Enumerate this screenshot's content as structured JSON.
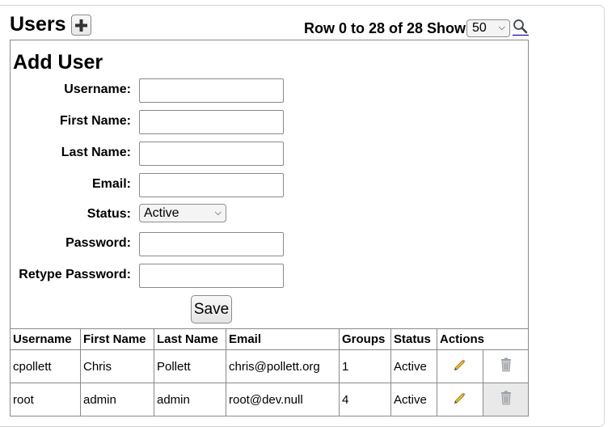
{
  "header": {
    "title": "Users",
    "add_icon": "plus-icon",
    "pager_text": "Row 0 to 28 of 28 Show",
    "show_count": "50",
    "search_icon": "magnifier-icon"
  },
  "form": {
    "title": "Add User",
    "fields": {
      "username": {
        "label": "Username:",
        "value": ""
      },
      "first_name": {
        "label": "First Name:",
        "value": ""
      },
      "last_name": {
        "label": "Last Name:",
        "value": ""
      },
      "email": {
        "label": "Email:",
        "value": ""
      },
      "status": {
        "label": "Status:",
        "value": "Active"
      },
      "password": {
        "label": "Password:",
        "value": ""
      },
      "retype_password": {
        "label": "Retype Password:",
        "value": ""
      }
    },
    "save_label": "Save"
  },
  "table": {
    "headers": [
      "Username",
      "First Name",
      "Last Name",
      "Email",
      "Groups",
      "Status",
      "Actions"
    ],
    "rows": [
      {
        "username": "cpollett",
        "first_name": "Chris",
        "last_name": "Pollett",
        "email": "chris@pollett.org",
        "groups": "1",
        "status": "Active"
      },
      {
        "username": "root",
        "first_name": "admin",
        "last_name": "admin",
        "email": "root@dev.null",
        "groups": "4",
        "status": "Active"
      }
    ],
    "edit_icon": "pencil-icon",
    "delete_icon": "trash-icon"
  }
}
